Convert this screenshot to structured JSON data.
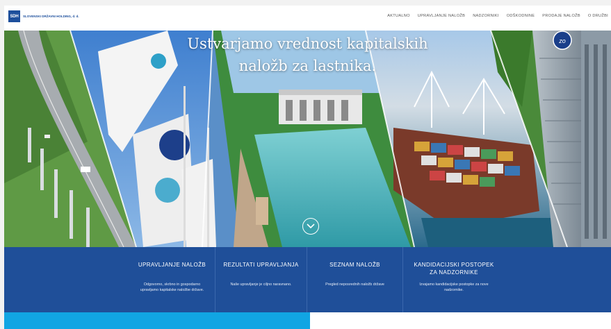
{
  "brand": {
    "logo_mark": "SDH",
    "name": "SLOVENSKI DRŽAVNI HOLDING, d. d."
  },
  "nav": {
    "items": [
      {
        "label": "AKTUALNO"
      },
      {
        "label": "UPRAVLJANJE NALOŽB"
      },
      {
        "label": "NADZORNIKI"
      },
      {
        "label": "ODŠKODNINE"
      },
      {
        "label": "PRODAJE NALOŽB"
      },
      {
        "label": "O DRUŽBI"
      }
    ]
  },
  "hero": {
    "title_line1": "Ustvarjamo vrednost kapitalskih",
    "title_line2": "naložb za lastnika.",
    "scroll_icon": "chevron-down-circle-icon"
  },
  "cards": [
    {
      "title": "UPRAVLJANJE NALOŽB",
      "title2": "",
      "description": "Odgovorno, skrbno in gospodarno upravljamo kapitalske naložbe države."
    },
    {
      "title": "REZULTATI UPRAVLJANJA",
      "title2": "",
      "description": "Naše upravljanje je ciljno naravnano."
    },
    {
      "title": "SEZNAM NALOŽB",
      "title2": "",
      "description": "Pregled neposrednih naložb države"
    },
    {
      "title": "KANDIDACIJSKI POSTOPEK",
      "title2": "ZA NADZORNIKE",
      "description": "Izvajamo kandidacijske postopke za nove nadzornike."
    }
  ],
  "colors": {
    "brand_blue": "#1f4f99",
    "accent_cyan": "#11a5e3"
  }
}
